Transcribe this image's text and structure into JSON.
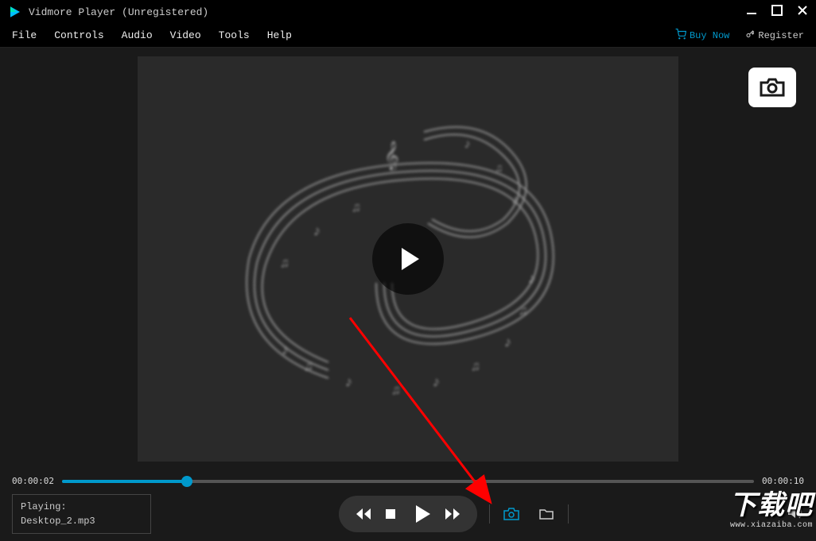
{
  "titlebar": {
    "title": "Vidmore Player (Unregistered)"
  },
  "menubar": {
    "items": [
      "File",
      "Controls",
      "Audio",
      "Video",
      "Tools",
      "Help"
    ],
    "buy_now": "Buy Now",
    "register": "Register"
  },
  "playback": {
    "current_time": "00:00:02",
    "total_time": "00:00:10",
    "progress_percent": 18
  },
  "now_playing": {
    "label": "Playing:",
    "file": "Desktop_2.mp3"
  },
  "colors": {
    "accent": "#0099cc"
  },
  "watermark": {
    "text": "下载吧",
    "url": "www.xiazaiba.com"
  }
}
